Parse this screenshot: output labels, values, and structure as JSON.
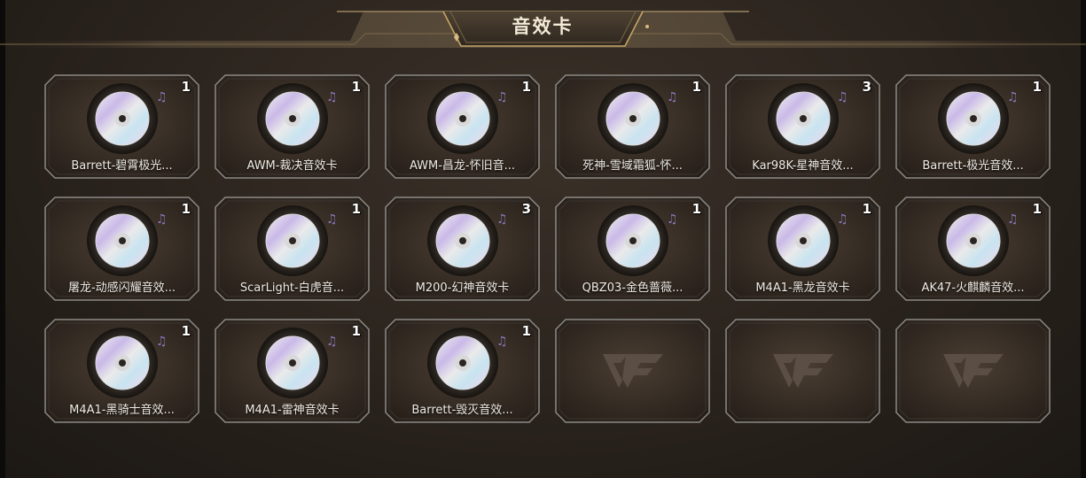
{
  "page": {
    "title": "音效卡"
  },
  "colors": {
    "accent": "#c7a566",
    "card_border": "#8c8a86",
    "card_bg": "#3a2f27"
  },
  "cards": [
    {
      "name": "Barrett-碧霄极光...",
      "count": "1",
      "icon": "music-disc-icon"
    },
    {
      "name": "AWM-裁决音效卡",
      "count": "1",
      "icon": "music-disc-icon"
    },
    {
      "name": "AWM-昌龙-怀旧音...",
      "count": "1",
      "icon": "music-disc-icon"
    },
    {
      "name": "死神-雪域霜狐-怀...",
      "count": "1",
      "icon": "music-disc-icon"
    },
    {
      "name": "Kar98K-星神音效...",
      "count": "3",
      "icon": "music-disc-icon"
    },
    {
      "name": "Barrett-极光音效...",
      "count": "1",
      "icon": "music-disc-icon"
    },
    {
      "name": "屠龙-动感闪耀音效...",
      "count": "1",
      "icon": "music-disc-icon"
    },
    {
      "name": "ScarLight-白虎音...",
      "count": "1",
      "icon": "music-disc-icon"
    },
    {
      "name": "M200-幻神音效卡",
      "count": "3",
      "icon": "music-disc-icon"
    },
    {
      "name": "QBZ03-金色蔷薇...",
      "count": "1",
      "icon": "music-disc-icon"
    },
    {
      "name": "M4A1-黑龙音效卡",
      "count": "1",
      "icon": "music-disc-icon"
    },
    {
      "name": "AK47-火麒麟音效...",
      "count": "1",
      "icon": "music-disc-icon"
    },
    {
      "name": "M4A1-黑骑士音效...",
      "count": "1",
      "icon": "music-disc-icon"
    },
    {
      "name": "M4A1-雷神音效卡",
      "count": "1",
      "icon": "music-disc-icon"
    },
    {
      "name": "Barrett-毁灭音效...",
      "count": "1",
      "icon": "music-disc-icon"
    }
  ],
  "empty_slots": [
    {
      "icon": "cf-logo-icon"
    },
    {
      "icon": "cf-logo-icon"
    },
    {
      "icon": "cf-logo-icon"
    }
  ]
}
